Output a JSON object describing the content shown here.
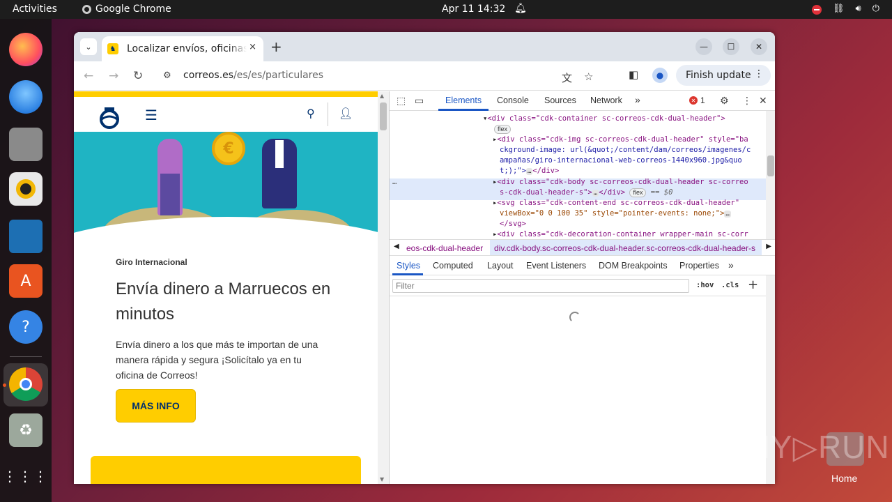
{
  "topbar": {
    "activities": "Activities",
    "app_name": "Google Chrome",
    "clock": "Apr 11  14:32"
  },
  "dock": {
    "items": [
      "firefox-icon",
      "thunderbird-icon",
      "files-icon",
      "rhythmbox-icon",
      "writer-icon",
      "app-center-icon",
      "help-icon",
      "chrome-icon",
      "trash-icon",
      "apps-grid-icon"
    ],
    "help_glyph": "?"
  },
  "chrome": {
    "tab_title": "Localizar envíos, oficinas",
    "tab_close": "×",
    "new_tab": "+",
    "url_host": "correos.es",
    "url_path": "/es/es/particulares",
    "finish_update": "Finish update"
  },
  "page": {
    "eyebrow": "Giro Internacional",
    "headline": "Envía dinero a Marruecos en minutos",
    "body": "Envía dinero a los que más te importan de una manera rápida y segura ¡Solicítalo ya en tu oficina de Correos!",
    "cta": "MÁS INFO",
    "coin_glyph": "€",
    "brand_colors": {
      "yellow": "#ffcd00",
      "blue": "#00306d",
      "teal": "#1fb4c3"
    }
  },
  "devtools": {
    "tabs": [
      "Elements",
      "Console",
      "Sources",
      "Network"
    ],
    "active_tab": "Elements",
    "more": "»",
    "error_count": "1",
    "dom_lines": {
      "l0": "<div class=\"cdk-container sc-correos-cdk-dual-header\">",
      "l1_badge": "flex",
      "l2": "<div class=\"cdk-img sc-correos-cdk-dual-header\" style=\"ba",
      "l3": "ckground-image: url(&quot;/content/dam/correos/imagenes/c",
      "l4": "ampañas/giro-internacional-web-correos-1440x960.jpg&quo",
      "l5": "t;);\">",
      "l5_end": "</div>",
      "l6": "<div class=\"cdk-body sc-correos-cdk-dual-header sc-correo",
      "l7": "s-cdk-dual-header-s\">",
      "l7_end": "</div>",
      "l7_badge": "flex",
      "l7_eq": "== $0",
      "l8": "<svg class=\"cdk-content-end sc-correos-cdk-dual-header\"",
      "l9": "viewBox=\"0 0 100 35\" style=\"pointer-events: none;\">",
      "l10": "</svg>",
      "l11": "<div class=\"cdk-decoration-container wrapper-main sc-corr",
      "ellipsis": "…",
      "row_dots": "…"
    },
    "breadcrumb": [
      "eos-cdk-dual-header",
      "div.cdk-body.sc-correos-cdk-dual-header.sc-correos-cdk-dual-header-s"
    ],
    "sub_tabs": [
      "Styles",
      "Computed",
      "Layout",
      "Event Listeners",
      "DOM Breakpoints",
      "Properties"
    ],
    "active_sub_tab": "Styles",
    "filter_placeholder": "Filter",
    "hov": ":hov",
    "cls": ".cls",
    "add": "+"
  },
  "desktop": {
    "watermark": "ANY▷RUN",
    "home_label": "Home"
  }
}
